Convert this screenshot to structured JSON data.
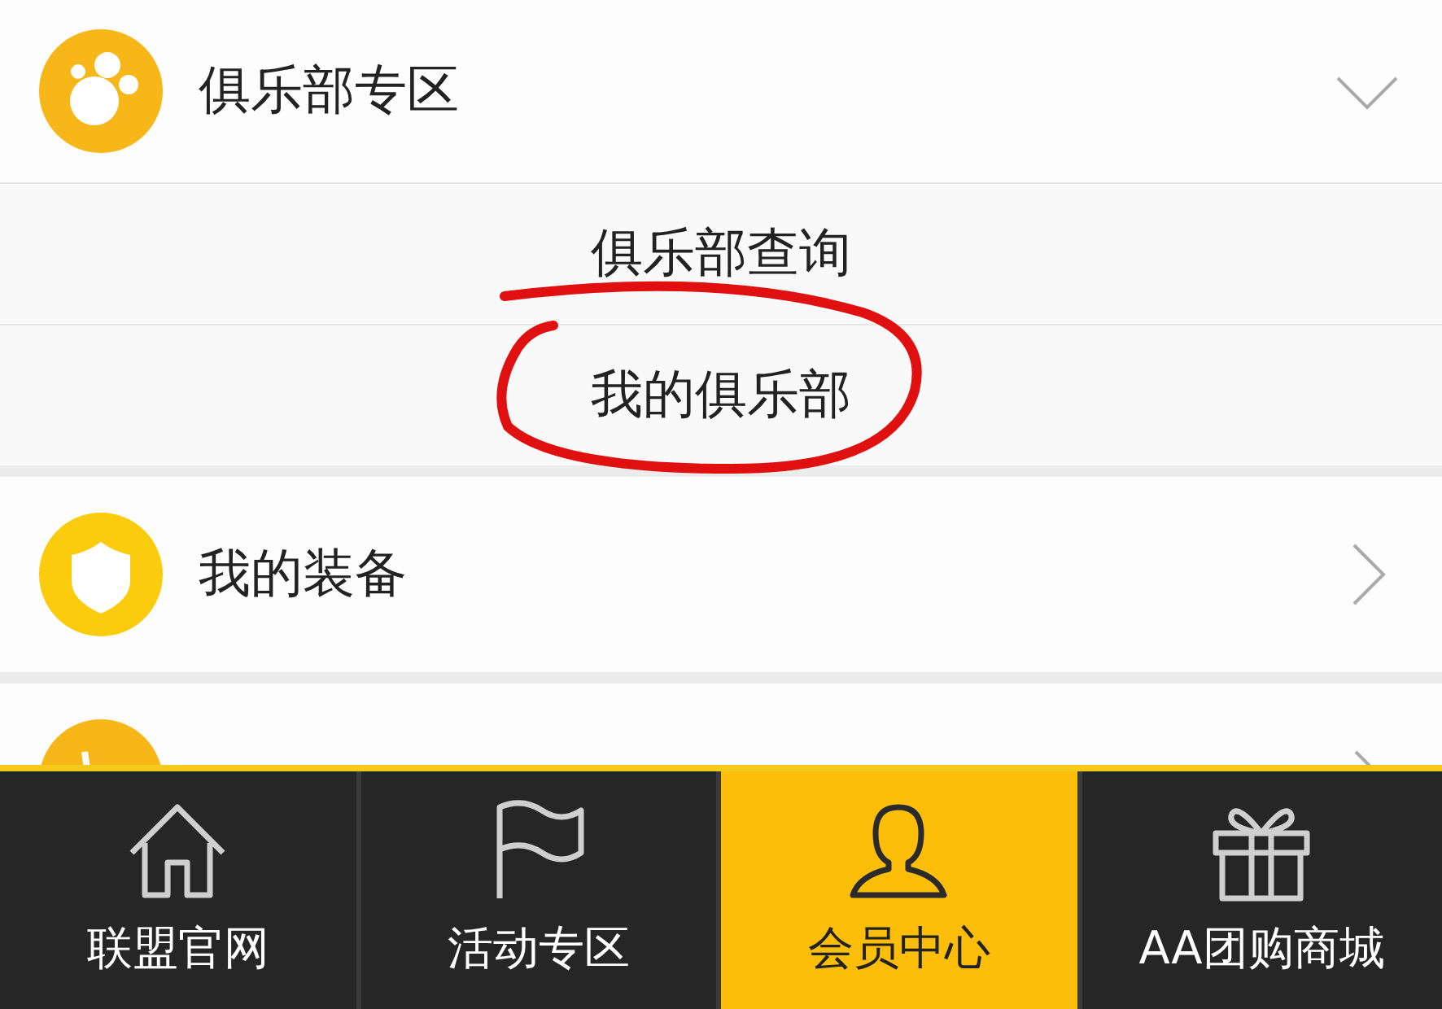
{
  "menu": [
    {
      "kind": "club",
      "label": "俱乐部专区",
      "expanded": true,
      "children": [
        {
          "label": "俱乐部查询"
        },
        {
          "label": "我的俱乐部"
        }
      ]
    },
    {
      "kind": "shield",
      "label": "我的装备",
      "expanded": false
    },
    {
      "kind": "activity",
      "expanded": false
    }
  ],
  "tabs": [
    {
      "kind": "home",
      "label": "联盟官网",
      "selected": false
    },
    {
      "kind": "flag",
      "label": "活动专区",
      "selected": false
    },
    {
      "kind": "person",
      "label": "会员中心",
      "selected": true
    },
    {
      "kind": "gift",
      "label": "AA团购商城",
      "selected": false
    }
  ]
}
